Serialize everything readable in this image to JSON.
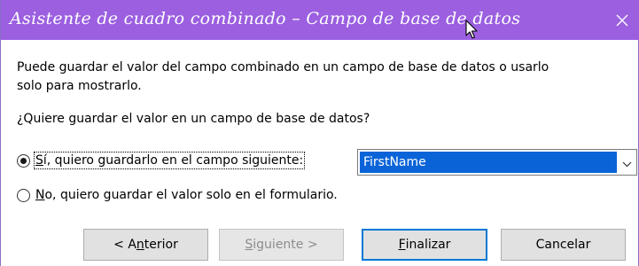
{
  "window": {
    "title": "Asistente de cuadro combinado – Campo de base de datos",
    "title_color": "#9b5fe0"
  },
  "description": {
    "line1": "Puede guardar el valor del campo combinado en un campo de base de datos o usarlo",
    "line2": "solo para mostrarlo."
  },
  "question": "¿Quiere guardar el valor en un campo de base de datos?",
  "options": [
    {
      "label_prefix": "",
      "label_mnemonic": "S",
      "label_rest": "í, quiero guardarlo en el campo siguiente:",
      "selected": true
    },
    {
      "label_prefix": "",
      "label_mnemonic": "N",
      "label_rest": "o, quiero guardar el valor solo en el formulario.",
      "selected": false
    }
  ],
  "field_select": {
    "value": "FirstName"
  },
  "buttons": {
    "previous": {
      "before": "< A",
      "mnemonic": "n",
      "after": "terior"
    },
    "next": {
      "before": "",
      "mnemonic": "S",
      "after": "iguiente >"
    },
    "finish": {
      "before": "",
      "mnemonic": "F",
      "after": "inalizar"
    },
    "cancel": {
      "label": "Cancelar"
    }
  },
  "icons": {
    "close": "close-icon",
    "cursor": "mouse-pointer-icon",
    "dropdown": "chevron-down-icon"
  }
}
